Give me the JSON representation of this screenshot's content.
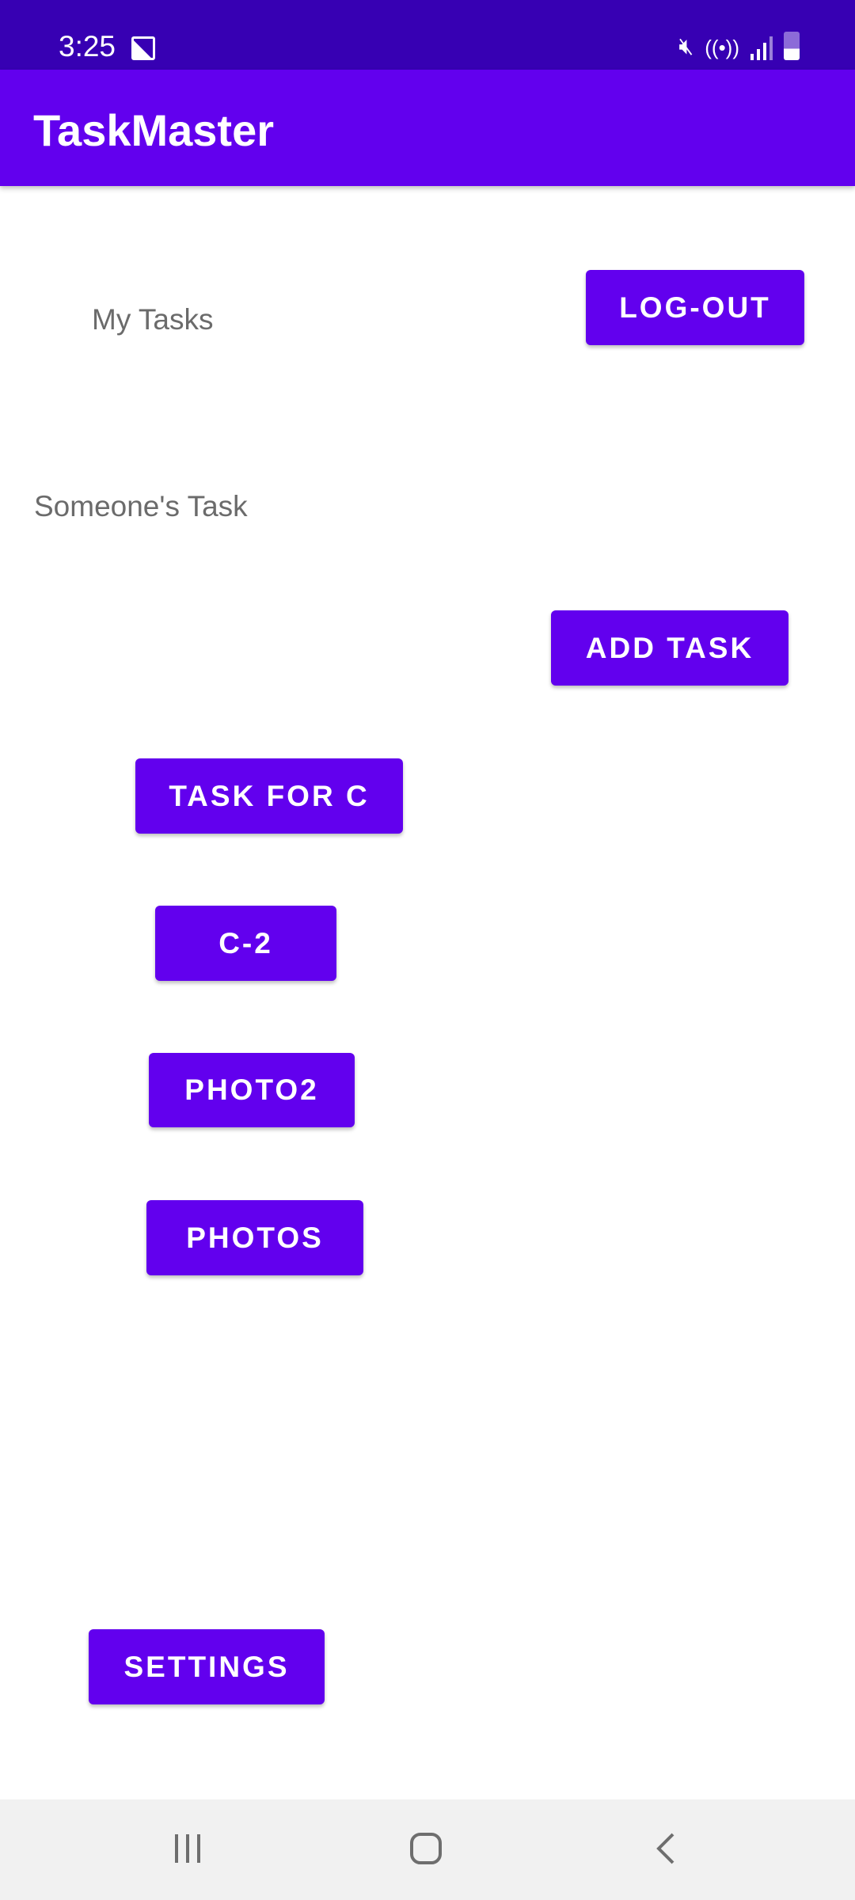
{
  "status_bar": {
    "time": "3:25",
    "icons": [
      "gallery-icon",
      "mute-icon",
      "wifi-icon",
      "signal-icon",
      "battery-charging-icon"
    ]
  },
  "app_bar": {
    "title": "TaskMaster"
  },
  "main": {
    "my_tasks_label": "My Tasks",
    "logout_label": "LOG-OUT",
    "user_task_label": "Someone's Task",
    "add_task_label": "ADD TASK",
    "tasks": [
      {
        "label": "TASK FOR C"
      },
      {
        "label": "C-2"
      },
      {
        "label": "PHOTO2"
      },
      {
        "label": "PHOTOS"
      }
    ],
    "settings_label": "SETTINGS"
  },
  "nav_bar": {
    "icons": [
      "recent-apps-icon",
      "home-icon",
      "back-icon"
    ]
  },
  "colors": {
    "primary": "#6200ee",
    "primary_dark": "#3700b3"
  }
}
